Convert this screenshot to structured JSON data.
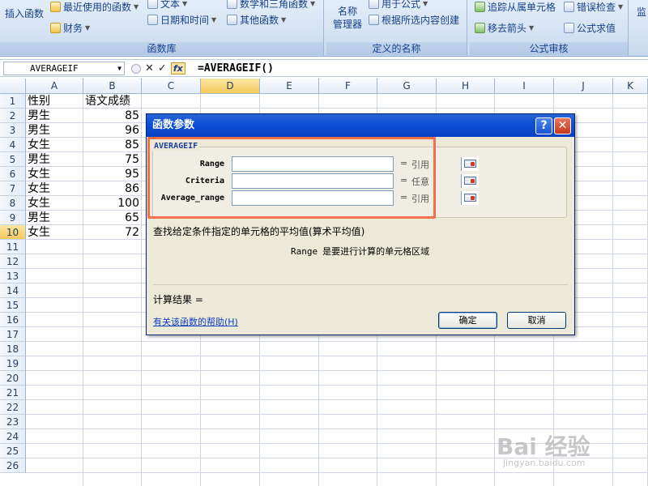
{
  "ribbon": {
    "insert_function": "插入函数",
    "recent": "最近使用的函数",
    "text": "文本",
    "math": "数学和三角函数",
    "finance": "财务",
    "datetime": "日期和时间",
    "other": "其他函数",
    "group_function_library": "函数库",
    "name_manager": "名称\n管理器",
    "name_manager_line1": "名称",
    "name_manager_line2": "管理器",
    "use_in_formula": "用于公式",
    "create_from_selection": "根据所选内容创建",
    "group_defined_names": "定义的名称",
    "trace_dependents": "追踪从属单元格",
    "error_check": "错误检查",
    "remove_arrows": "移去箭头",
    "evaluate_formula": "公式求值",
    "group_formula_auditing": "公式审核",
    "watch": "监"
  },
  "formula_bar": {
    "name_box": "AVERAGEIF",
    "fx": "fx",
    "formula": "=AVERAGEIF()"
  },
  "grid": {
    "columns": [
      "A",
      "B",
      "C",
      "D",
      "E",
      "F",
      "G",
      "H",
      "I",
      "J",
      "K"
    ],
    "rows": [
      "1",
      "2",
      "3",
      "4",
      "5",
      "6",
      "7",
      "8",
      "9",
      "10",
      "11",
      "12",
      "13",
      "14",
      "15",
      "16",
      "17",
      "18",
      "19",
      "20",
      "21",
      "22",
      "23",
      "24",
      "25",
      "26"
    ],
    "cells": [
      {
        "a": "性别",
        "b": "语文成绩"
      },
      {
        "a": "男生",
        "b": "85"
      },
      {
        "a": "男生",
        "b": "96"
      },
      {
        "a": "女生",
        "b": "85"
      },
      {
        "a": "男生",
        "b": "75"
      },
      {
        "a": "女生",
        "b": "95"
      },
      {
        "a": "女生",
        "b": "86"
      },
      {
        "a": "女生",
        "b": "100"
      },
      {
        "a": "男生",
        "b": "65"
      },
      {
        "a": "女生",
        "b": "72"
      }
    ]
  },
  "dialog": {
    "title": "函数参数",
    "function_name": "AVERAGEIF",
    "args": [
      {
        "label": "Range",
        "eq": "=",
        "hint": "引用"
      },
      {
        "label": "Criteria",
        "eq": "=",
        "hint": "任意"
      },
      {
        "label": "Average_range",
        "eq": "=",
        "hint": "引用"
      }
    ],
    "description": "查找给定条件指定的单元格的平均值(算术平均值)",
    "param_name": "Range",
    "param_desc": "是要进行计算的单元格区域",
    "result_label": "计算结果 =",
    "help_link": "有关该函数的帮助(H)",
    "ok": "确定",
    "cancel": "取消",
    "help_btn": "?",
    "close_btn": "✕"
  },
  "watermark": {
    "brand": "Bai 经验",
    "url": "jingyan.baidu.com"
  }
}
